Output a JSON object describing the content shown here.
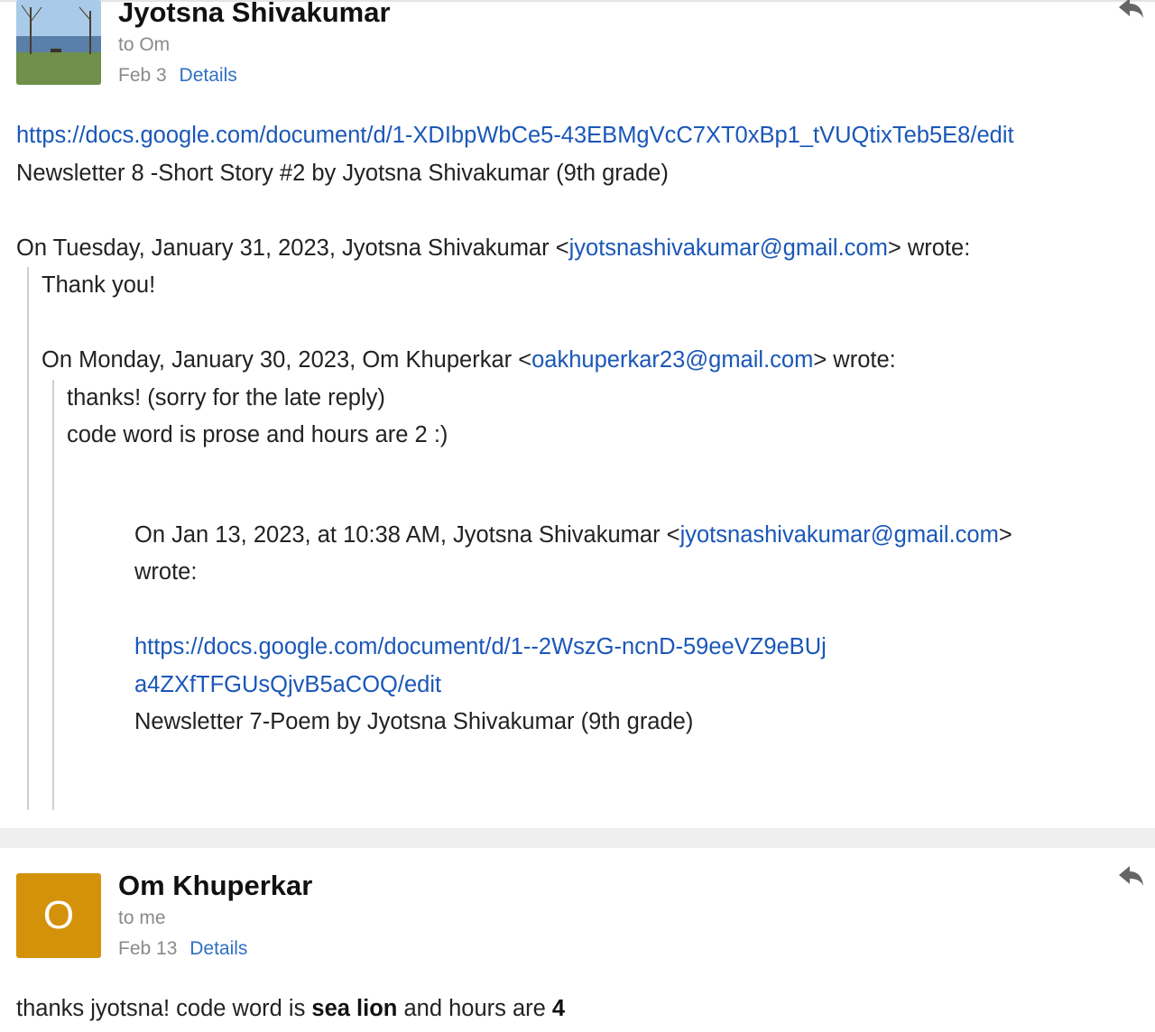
{
  "message1": {
    "sender": "Jyotsna Shivakumar",
    "to": "to Om",
    "date": "Feb 3",
    "details": "Details",
    "avatar_icon": "lake-landscape-photo",
    "body": {
      "link1": "https://docs.google.com/document/d/1-XDIbpWbCe5-43EBMgVcC7XT0xBp1_tVUQtixTeb5E8/edit",
      "line2": "Newsletter 8 -Short Story #2 by Jyotsna Shivakumar (9th grade)",
      "quote1_header_pre": "On Tuesday, January 31, 2023, Jyotsna Shivakumar <",
      "quote1_header_email": "jyotsnashivakumar@gmail.com",
      "quote1_header_post": "> wrote:",
      "quote1_text": "Thank you!",
      "quote2_header_pre": "On Monday, January 30, 2023, Om Khuperkar <",
      "quote2_header_email": "oakhuperkar23@gmail.com",
      "quote2_header_post": "> wrote:",
      "quote2_line1": "thanks! (sorry for the late reply)",
      "quote2_line2": "code word is prose and hours are 2 :)",
      "quote3_header_pre": "On Jan 13, 2023, at 10:38 AM, Jyotsna Shivakumar <",
      "quote3_header_email": "jyotsnashivakumar@gmail.com",
      "quote3_header_post": ">",
      "quote3_header_wrote": "wrote:",
      "quote3_link_part1": "https://docs.google.com/document/d/1--2WszG-ncnD-59eeVZ9eBUj",
      "quote3_link_part2": "a4ZXfTFGUsQjvB5aCOQ/edit",
      "quote3_text": "Newsletter 7-Poem by Jyotsna Shivakumar (9th grade)"
    }
  },
  "message2": {
    "sender": "Om Khuperkar",
    "to": "to me",
    "date": "Feb 13",
    "details": "Details",
    "avatar_letter": "O",
    "body": {
      "pre": "thanks jyotsna! code word is ",
      "bold1": "sea lion",
      "mid": " and hours are ",
      "bold2": "4"
    }
  },
  "colors": {
    "link": "#1a57b8",
    "avatar_o": "#d4920b",
    "muted": "#8a8a8a"
  }
}
